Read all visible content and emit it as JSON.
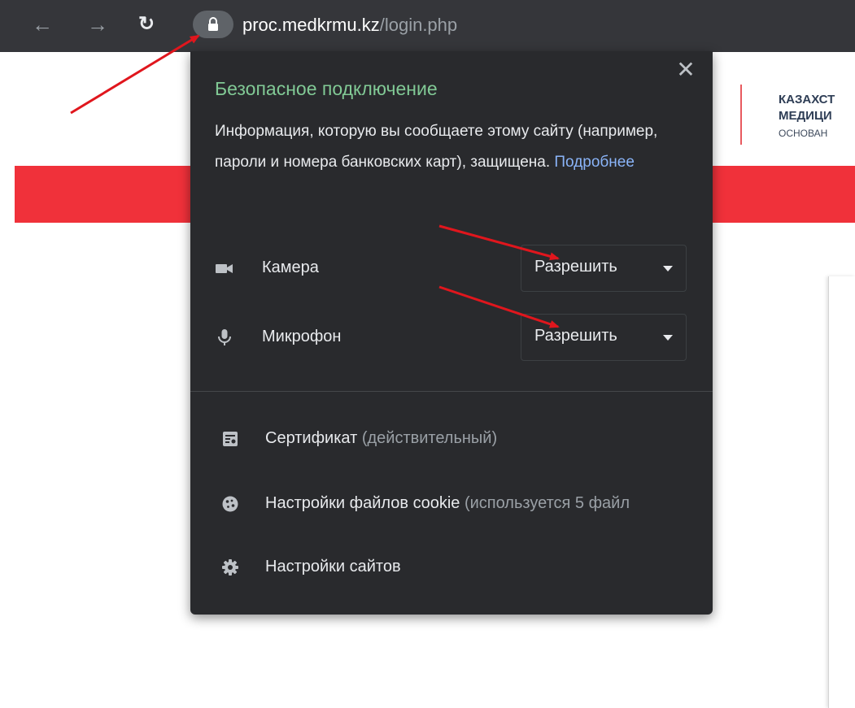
{
  "browser": {
    "url_host": "proc.medkrmu.kz",
    "url_path": "/login.php",
    "back_icon": "arrow-left-icon",
    "forward_icon": "arrow-right-icon",
    "reload_icon": "reload-icon",
    "lock_icon": "lock-icon"
  },
  "page": {
    "org_line1": "КАЗАХСТ",
    "org_line2": "МЕДИЦИ",
    "org_line3": "ОСНОВАН",
    "accent_color": "#f0313a"
  },
  "site_info_popup": {
    "title": "Безопасное подключение",
    "description": "Информация, которую вы сообщаете этому сайту (например, пароли и номера банковских карт), защищена.",
    "more_link": "Подробнее",
    "permissions": [
      {
        "label": "Камера",
        "value": "Разрешить",
        "icon": "camera-icon"
      },
      {
        "label": "Микрофон",
        "value": "Разрешить",
        "icon": "microphone-icon"
      }
    ],
    "menu": [
      {
        "label": "Сертификат",
        "note": "(действительный)",
        "icon": "certificate-icon"
      },
      {
        "label": "Настройки файлов cookie",
        "note": "(используется 5 файл",
        "icon": "cookie-icon"
      },
      {
        "label": "Настройки сайтов",
        "note": "",
        "icon": "gear-icon"
      }
    ],
    "title_color": "#81c995",
    "link_color": "#8ab4f8"
  }
}
